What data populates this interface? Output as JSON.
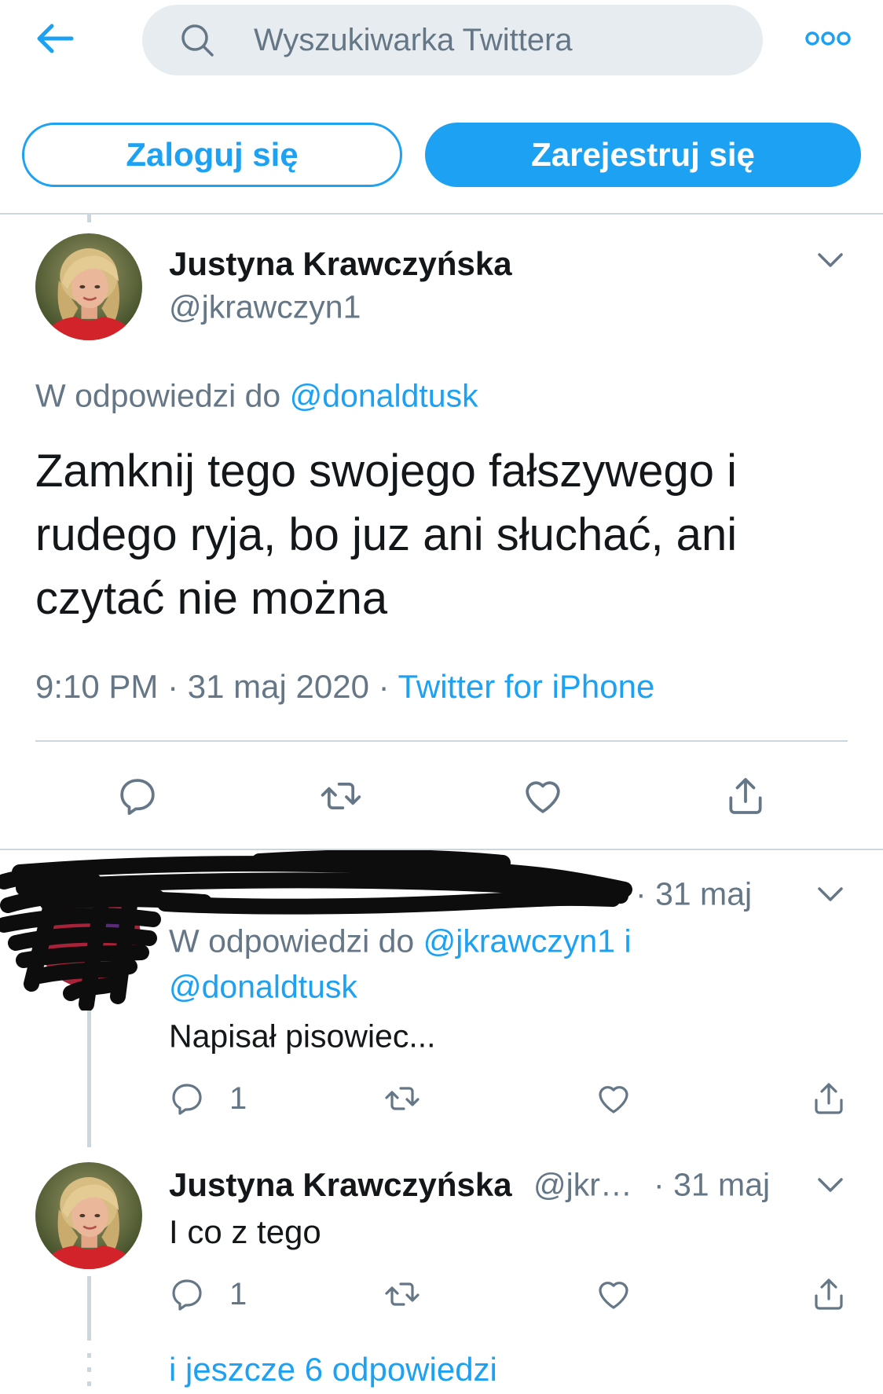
{
  "header": {
    "search_placeholder": "Wyszukiwarka Twittera",
    "back_icon": "arrow-left-icon",
    "search_icon": "search-icon",
    "more_icon": "more-icon"
  },
  "auth": {
    "login_label": "Zaloguj się",
    "register_label": "Zarejestruj się"
  },
  "separator": "·",
  "main_tweet": {
    "author_name": "Justyna Krawczyńska",
    "author_handle": "@jkrawczyn1",
    "reply_prefix": "W odpowiedzi do",
    "reply_to": "@donaldtusk",
    "text_lines": [
      "Zamknij tego swojego fałszywego i",
      "rudego ryja, bo juz ani słuchać, ani",
      "czytać nie można"
    ],
    "time": "9:10 PM",
    "date": "31 maj 2020",
    "source": "Twitter for iPhone",
    "action_icons": [
      "reply-icon",
      "retweet-icon",
      "heart-icon",
      "share-icon"
    ]
  },
  "replies": [
    {
      "date": "31 maj",
      "reply_prefix": "W odpowiedzi do",
      "reply_to": [
        "@jkrawczyn1",
        "@donaldtusk"
      ],
      "reply_conjunction": "i",
      "text": "Napisał pisowiec...",
      "reply_count": "1"
    },
    {
      "author_name": "Justyna Krawczyńska",
      "author_handle": "@jkr…",
      "date": "31 maj",
      "text": "I co z tego",
      "reply_count": "1"
    }
  ],
  "more_replies": "i jeszcze 6 odpowiedzi",
  "icons": {
    "chevron": "chevron-down-icon",
    "reply": "reply-icon",
    "retweet": "retweet-icon",
    "like": "heart-icon",
    "share": "share-icon"
  },
  "colors": {
    "accent": "#1da1f2",
    "text": "#14171a",
    "secondary": "#657786",
    "border": "#ccd6dd",
    "search_bg": "#e6ecf0"
  }
}
